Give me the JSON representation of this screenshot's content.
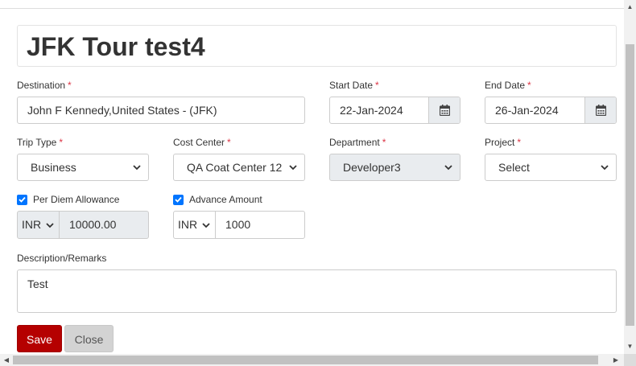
{
  "form": {
    "title": "JFK Tour test4",
    "destination": {
      "label": "Destination",
      "required_mark": "*",
      "value": "John F Kennedy,United States -  (JFK)"
    },
    "start_date": {
      "label": "Start Date",
      "required_mark": "*",
      "value": "22-Jan-2024"
    },
    "end_date": {
      "label": "End Date",
      "required_mark": "*",
      "value": "26-Jan-2024"
    },
    "trip_type": {
      "label": "Trip Type",
      "required_mark": "*",
      "value": "Business"
    },
    "cost_center": {
      "label": "Cost Center",
      "required_mark": "*",
      "value": "QA Coat Center 12"
    },
    "department": {
      "label": "Department",
      "required_mark": "*",
      "value": "Developer3"
    },
    "project": {
      "label": "Project",
      "required_mark": "*",
      "value": "Select"
    },
    "per_diem": {
      "label": "Per Diem Allowance",
      "checked": true,
      "currency": "INR",
      "amount": "10000.00"
    },
    "advance": {
      "label": "Advance Amount",
      "checked": true,
      "currency": "INR",
      "amount": "1000"
    },
    "description": {
      "label": "Description/Remarks",
      "value": "Test"
    }
  },
  "buttons": {
    "save": "Save",
    "close": "Close"
  },
  "colors": {
    "save_bg": "#b50000",
    "close_bg": "#d3d3d3",
    "checkbox": "#0075ff",
    "required": "#dc3545"
  },
  "icons": {
    "calendar": "calendar-icon",
    "dropdown": "chevron-down-icon",
    "check": "check-icon"
  }
}
